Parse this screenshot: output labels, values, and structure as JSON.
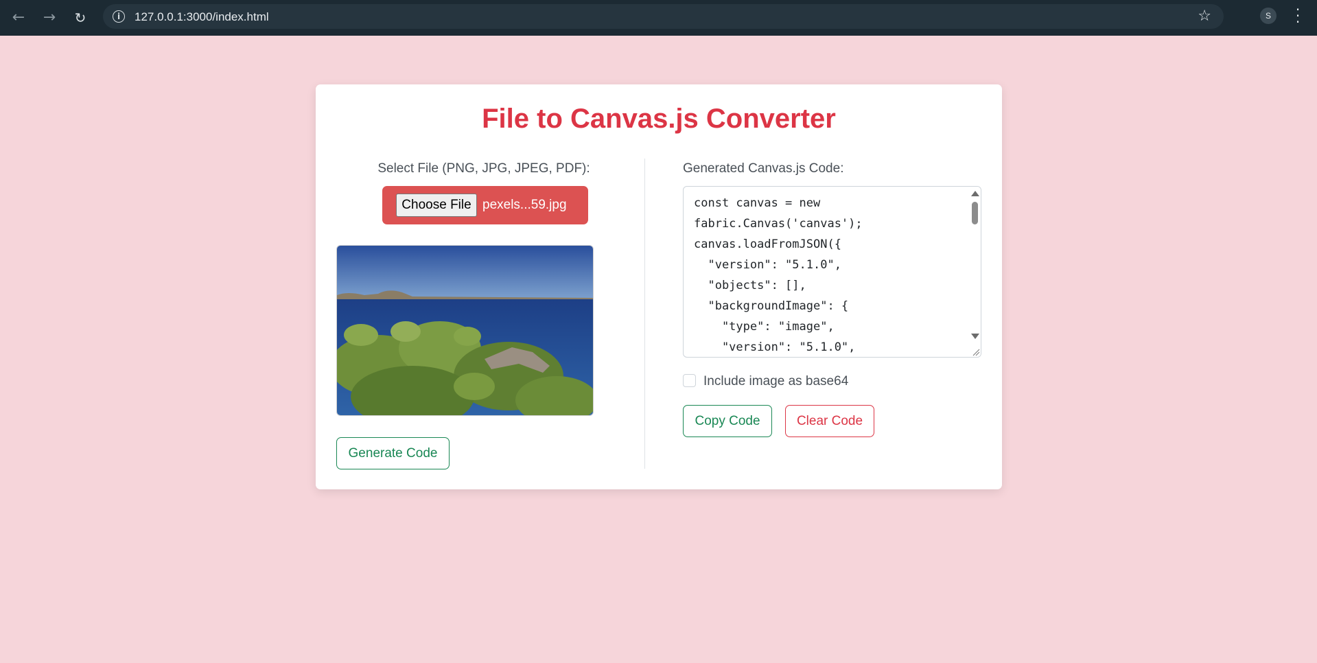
{
  "browser": {
    "url": "127.0.0.1:3000/index.html",
    "profile_initial": "S",
    "icons": [
      "back-arrow-icon",
      "forward-arrow-icon",
      "reload-icon",
      "info-icon",
      "star-icon",
      "kebab-menu-icon"
    ]
  },
  "page": {
    "title": "File to Canvas.js Converter",
    "background_color": "#f6d5da",
    "accent_color": "#dc3545",
    "success_color": "#198754"
  },
  "file_input": {
    "label": "Select File (PNG, JPG, JPEG, PDF):",
    "button_label": "Choose File",
    "file_name": "pexels...59.jpg",
    "box_color": "#dc5252"
  },
  "preview": {
    "description_icon": "image-preview"
  },
  "generate_button": "Generate Code",
  "code_panel": {
    "label": "Generated Canvas.js Code:",
    "code": "const canvas = new\nfabric.Canvas('canvas');\ncanvas.loadFromJSON({\n  \"version\": \"5.1.0\",\n  \"objects\": [],\n  \"backgroundImage\": {\n    \"type\": \"image\",\n    \"version\": \"5.1.0\","
  },
  "options": {
    "include_base64_label": "Include image as base64",
    "include_base64_checked": false
  },
  "actions": {
    "copy_label": "Copy Code",
    "clear_label": "Clear Code"
  }
}
